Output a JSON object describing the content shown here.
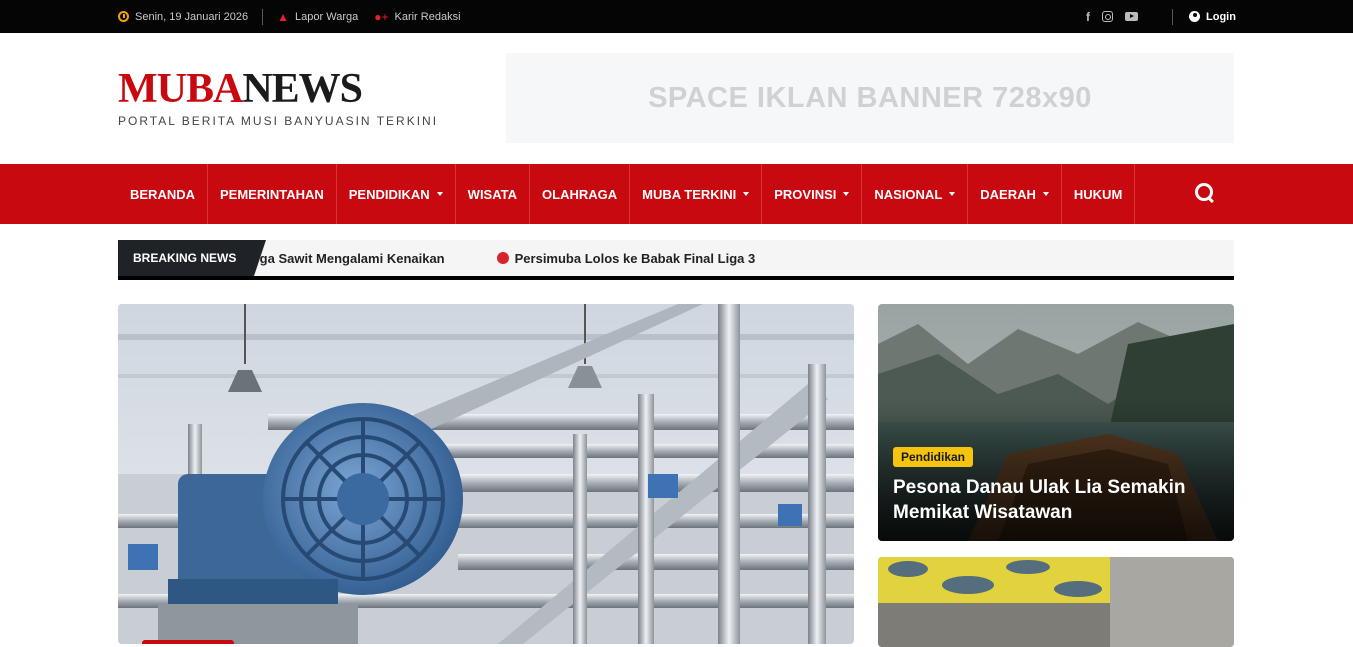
{
  "topbar": {
    "date": "Senin, 19 Januari 2026",
    "lapor": "Lapor Warga",
    "karir": "Karir Redaksi",
    "social_facebook": "f",
    "login": "Login"
  },
  "header": {
    "logo_red": "MUBA",
    "logo_dark": "NEWS",
    "tagline": "PORTAL BERITA MUSI BANYUASIN TERKINI",
    "banner_text": "SPACE IKLAN BANNER 728x90"
  },
  "nav": {
    "items": [
      {
        "label": "BERANDA"
      },
      {
        "label": "PEMERINTAHAN"
      },
      {
        "label": "PENDIDIKAN"
      },
      {
        "label": "WISATA"
      },
      {
        "label": "OLAHRAGA"
      },
      {
        "label": "MUBA TERKINI"
      },
      {
        "label": "PROVINSI"
      },
      {
        "label": "NASIONAL"
      },
      {
        "label": "DAERAH"
      },
      {
        "label": "HUKUM"
      }
    ]
  },
  "breaking": {
    "label": "BREAKING NEWS",
    "items": [
      "Harga Sawit Mengalami Kenaikan",
      "Persimuba Lolos ke Babak Final Liga 3"
    ]
  },
  "featured": {
    "side1": {
      "category": "Pendidikan",
      "title": "Pesona Danau Ulak Lia Semakin Memikat Wisatawan"
    }
  },
  "colors": {
    "brand_red": "#c8090f",
    "topbar": "#050505",
    "badge_yellow": "#f4c40f"
  }
}
